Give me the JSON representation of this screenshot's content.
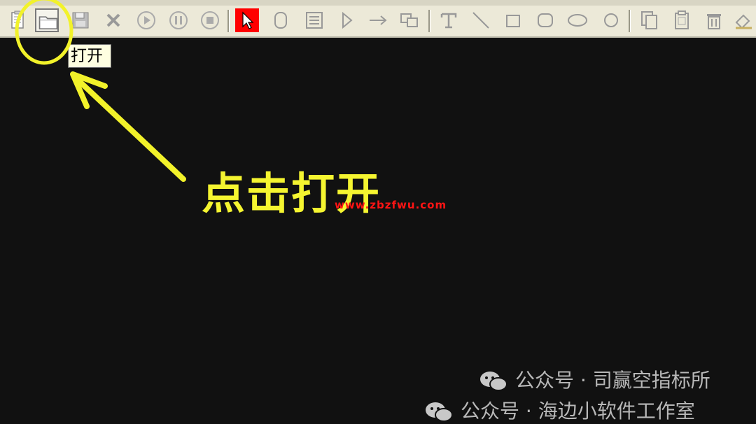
{
  "toolbar": {
    "buttons": [
      {
        "name": "new-document-button",
        "icon": "document-icon"
      },
      {
        "name": "open-button",
        "icon": "folder-icon",
        "state": "pressed"
      },
      {
        "name": "save-button",
        "icon": "floppy-disk-icon"
      },
      {
        "name": "close-button",
        "icon": "x-icon"
      },
      {
        "name": "play-button",
        "icon": "play-circle-icon"
      },
      {
        "name": "pause-button",
        "icon": "pause-circle-icon"
      },
      {
        "name": "stop-button",
        "icon": "stop-circle-icon"
      },
      {
        "name": "pointer-tool-button",
        "icon": "pointer-arrow-icon",
        "state": "active",
        "active_color": "#ff0000"
      },
      {
        "name": "rounded-rect-tool-button",
        "icon": "capsule-icon"
      },
      {
        "name": "text-box-tool-button",
        "icon": "text-box-icon"
      },
      {
        "name": "triangle-tool-button",
        "icon": "triangle-icon"
      },
      {
        "name": "arrow-tool-button",
        "icon": "right-arrow-icon"
      },
      {
        "name": "image-tool-button",
        "icon": "image-frame-icon"
      },
      {
        "name": "text-tool-button",
        "icon": "text-t-icon"
      },
      {
        "name": "line-tool-button",
        "icon": "line-icon"
      },
      {
        "name": "rectangle-tool-button",
        "icon": "square-icon"
      },
      {
        "name": "rounded-rectangle-tool-button",
        "icon": "rounded-square-icon"
      },
      {
        "name": "ellipse-tool-button",
        "icon": "ellipse-icon"
      },
      {
        "name": "circle-tool-button",
        "icon": "circle-icon"
      },
      {
        "name": "copy-button",
        "icon": "copy-icon"
      },
      {
        "name": "paste-button",
        "icon": "clipboard-icon"
      },
      {
        "name": "delete-button",
        "icon": "trash-icon"
      },
      {
        "name": "fill-button",
        "icon": "paint-bucket-icon"
      }
    ]
  },
  "tooltip": {
    "text": "打开"
  },
  "annotation": {
    "text": "点击打开",
    "color": "#f5f530",
    "highlight": "yellow-circle",
    "pointer": "yellow-arrow"
  },
  "watermarks": {
    "site": "www.zbzfwu.com",
    "line1": "公众号 · 司赢空指标所",
    "line2": "公众号 · 海边小软件工作室"
  },
  "colors": {
    "toolbar_bg": "#ece9d8",
    "canvas_bg": "#111111",
    "url_watermark": "#ff1414"
  }
}
